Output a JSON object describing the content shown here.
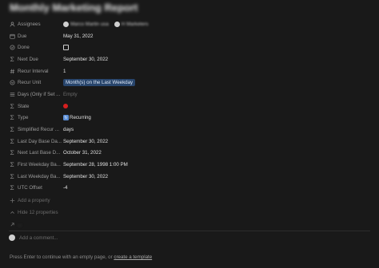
{
  "page": {
    "title": "Monthly Marketing Report"
  },
  "properties": [
    {
      "key": "assignees",
      "label": "Assignees",
      "icon": "people-icon",
      "type": "people",
      "people": [
        {
          "name": "Marco Martin usa"
        },
        {
          "name": "H Marketers"
        }
      ]
    },
    {
      "key": "due",
      "label": "Due",
      "icon": "calendar-icon",
      "type": "text",
      "value": "May 31, 2022"
    },
    {
      "key": "done",
      "label": "Done",
      "icon": "checkbox-icon",
      "type": "checkbox",
      "checked": false
    },
    {
      "key": "next_due",
      "label": "Next Due",
      "icon": "formula-icon",
      "type": "text",
      "value": "September 30, 2022"
    },
    {
      "key": "recur_interval",
      "label": "Recur Interval",
      "icon": "number-icon",
      "type": "text",
      "value": "1"
    },
    {
      "key": "recur_unit",
      "label": "Recur Unit",
      "icon": "select-icon",
      "type": "tag",
      "value": "Month(s) on the Last Weekday"
    },
    {
      "key": "days",
      "label": "Days (Only if Set ...",
      "icon": "list-icon",
      "type": "empty",
      "value": "Empty"
    },
    {
      "key": "state",
      "label": "State",
      "icon": "formula-icon",
      "type": "dot",
      "color": "#d61f1f"
    },
    {
      "key": "type",
      "label": "Type",
      "icon": "formula-icon",
      "type": "recurring",
      "value": "Recurring"
    },
    {
      "key": "simplified_recur",
      "label": "Simplified Recur ...",
      "icon": "formula-icon",
      "type": "text",
      "value": "days"
    },
    {
      "key": "last_day_base",
      "label": "Last Day Base Da...",
      "icon": "formula-icon",
      "type": "text",
      "value": "September 30, 2022"
    },
    {
      "key": "next_last_base",
      "label": "Next Last Base D...",
      "icon": "formula-icon",
      "type": "text",
      "value": "October 31, 2022"
    },
    {
      "key": "first_weekday_base",
      "label": "First Weekday Ba...",
      "icon": "formula-icon",
      "type": "text",
      "value": "September 28, 1998 1:00 PM"
    },
    {
      "key": "last_weekday_base",
      "label": "Last Weekday Ba...",
      "icon": "formula-icon",
      "type": "text",
      "value": "September 30, 2022"
    },
    {
      "key": "utc_offset",
      "label": "UTC Offset",
      "icon": "formula-icon",
      "type": "text",
      "value": "-4"
    }
  ],
  "actions": {
    "add_property": "Add a property",
    "hide_properties": "Hide 12 properties",
    "unknown": "..."
  },
  "comment": {
    "placeholder": "Add a comment..."
  },
  "footer": {
    "prefix": "Press Enter to continue with an empty page, or ",
    "link": "create a template"
  },
  "colors": {
    "background": "#191919",
    "tag_background": "#28456c",
    "state_dot": "#d61f1f"
  }
}
